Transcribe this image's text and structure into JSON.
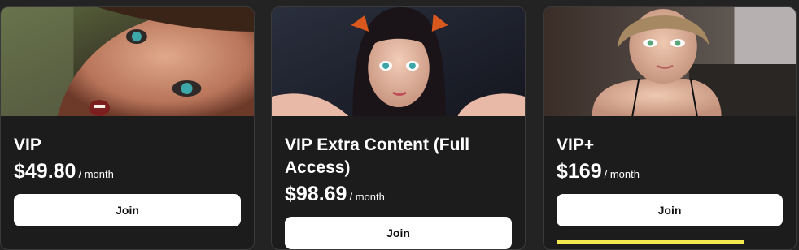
{
  "tiers": [
    {
      "name": "VIP",
      "price": "$49.80",
      "period": "/ month",
      "button_label": "Join",
      "image_icon": "character-portrait-image"
    },
    {
      "name": "VIP Extra Content (Full Access)",
      "price": "$98.69",
      "period": "/ month",
      "button_label": "Join",
      "image_icon": "character-portrait-image"
    },
    {
      "name": "VIP+",
      "price": "$169",
      "period": "/ month",
      "button_label": "Join",
      "image_icon": "character-portrait-image"
    }
  ],
  "colors": {
    "page_background": "#232323",
    "card_background": "#1c1c1c",
    "card_border": "#3a3a3a",
    "button_background": "#ffffff",
    "button_text": "#111111",
    "promo_accent": "#f2e94e"
  }
}
